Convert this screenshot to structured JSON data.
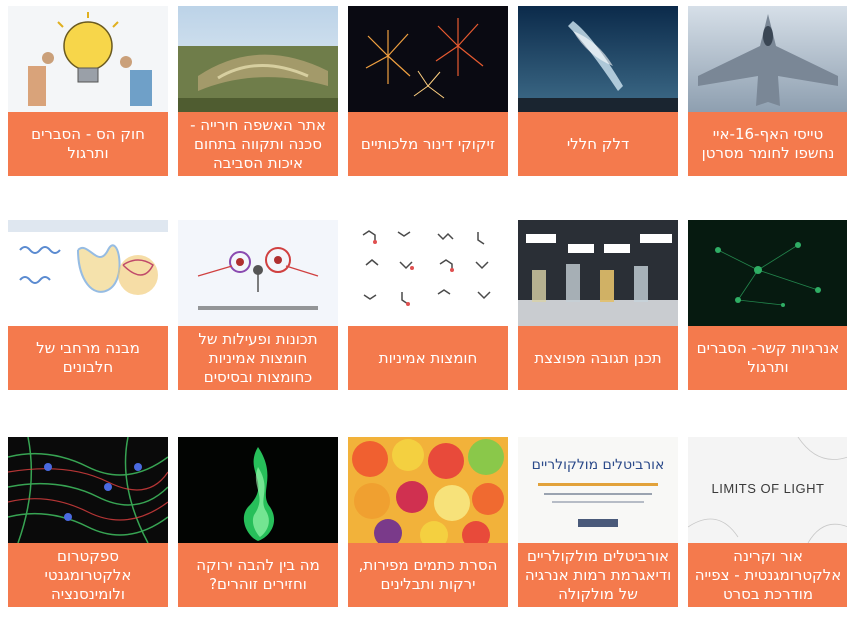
{
  "cards": [
    {
      "title": "טייסי האף-16-איי נחשפו לחומר מסרטן",
      "thumb": "fighter-jet-image"
    },
    {
      "title": "דלק חללי",
      "thumb": "rocket-launch-image"
    },
    {
      "title": "זיקוקי דינור מלכותיים",
      "thumb": "fireworks-image"
    },
    {
      "title": "אתר האשפה חירייה - סכנה ותקווה בתחום איכות הסביבה",
      "thumb": "landfill-hill-image"
    },
    {
      "title": "חוק הס - הסברים ותרגול",
      "thumb": "lightbulb-cartoon-image"
    },
    {
      "title": "אנרגיות קשר- הסברים ותרגול",
      "thumb": "green-network-image"
    },
    {
      "title": "תכנן תגובה מפוצצת",
      "thumb": "lab-flasks-image"
    },
    {
      "title": "חומצות אמיניות",
      "thumb": "amino-acid-molecules-image"
    },
    {
      "title": "תכונות ופעילות של חומצות אמיניות כחומצות ובסיסים",
      "thumb": "amino-acid-structure-image"
    },
    {
      "title": "מבנה מרחבי של חלבונים",
      "thumb": "protein-structure-image"
    },
    {
      "title": "אור וקרינה אלקטרומגנטית - צפייה מודרכת בסרט",
      "thumb": "limits-of-light-image",
      "thumb_text": "LIMITS OF LIGHT"
    },
    {
      "title": "אורביטלים מולקולריים ודיאגרמת רמות אנרגיה של מולקולה",
      "thumb": "orbitals-slide-image",
      "thumb_text": "אורביטלים מולקולריים"
    },
    {
      "title": "הסרת כתמים מפירות, ירקות ותבלינים",
      "thumb": "fruits-image"
    },
    {
      "title": "מה בין להבה ירוקה וחזירים זוהרים?",
      "thumb": "green-flame-image"
    },
    {
      "title": "ספקטרום אלקטרומגנטי ולומינסנציה",
      "thumb": "fluorescent-cells-image"
    }
  ],
  "colors": {
    "caption_bg": "#f47a4d",
    "caption_text": "#ffffff"
  }
}
